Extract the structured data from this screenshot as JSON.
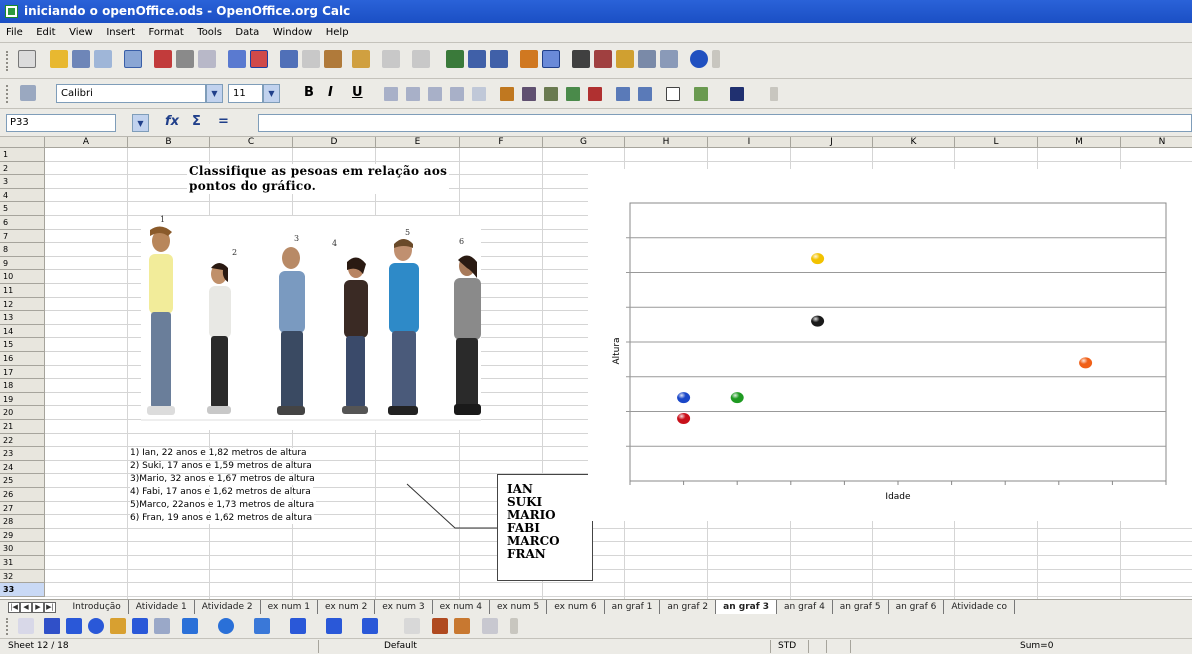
{
  "window": {
    "title": "iniciando o openOffice.ods - OpenOffice.org Calc"
  },
  "menu": [
    "File",
    "Edit",
    "View",
    "Insert",
    "Format",
    "Tools",
    "Data",
    "Window",
    "Help"
  ],
  "format_toolbar": {
    "font_name": "Calibri",
    "font_size": "11",
    "bold": "B",
    "italic": "I",
    "underline": "U"
  },
  "formula_bar": {
    "cell_ref": "P33",
    "fx": "fx",
    "sum": "Σ",
    "equals": "="
  },
  "columns": [
    "A",
    "B",
    "C",
    "D",
    "E",
    "F",
    "G",
    "H",
    "I",
    "J",
    "K",
    "L",
    "M",
    "N"
  ],
  "rows": [
    "1",
    "2",
    "3",
    "4",
    "5",
    "6",
    "7",
    "8",
    "9",
    "10",
    "11",
    "12",
    "13",
    "14",
    "15",
    "16",
    "17",
    "18",
    "19",
    "20",
    "21",
    "22",
    "23",
    "24",
    "25",
    "26",
    "27",
    "28",
    "29",
    "30",
    "31",
    "32",
    "33"
  ],
  "question": {
    "line1": "Classifique as pesoas em relação aos",
    "line2": "pontos do gráfico."
  },
  "photo_numbers": [
    "1",
    "2",
    "3",
    "4",
    "5",
    "6"
  ],
  "descriptions": [
    "1) Ian, 22 anos e 1,82 metros de altura",
    "2) Suki, 17 anos e 1,59 metros de altura",
    "3)Mario, 32 anos  e 1,67 metros de altura",
    "4) Fabi, 17 anos e 1,62 metros de altura",
    "5)Marco, 22anos e 1,73 metros de altura",
    "6) Fran, 19 anos e 1,62 metros de altura"
  ],
  "legend": [
    {
      "name": "IAN",
      "color": "#f0f020"
    },
    {
      "name": "SUKI",
      "color": "#e8141c"
    },
    {
      "name": "MARIO",
      "color": "#ff7a1a"
    },
    {
      "name": "FABI",
      "color": "#1440b8"
    },
    {
      "name": "MARCO",
      "color": "#333333"
    },
    {
      "name": "FRAN",
      "color": "#28d02c"
    }
  ],
  "chart_data": {
    "type": "scatter",
    "xlabel": "Idade",
    "ylabel": "Altura",
    "title": "",
    "grid": true,
    "x_range": [
      15,
      35
    ],
    "y_range": [
      1.5,
      1.9
    ],
    "points": [
      {
        "x": 22,
        "y": 1.82,
        "color": "#f2c200"
      },
      {
        "x": 22,
        "y": 1.73,
        "color": "#1a1a1a"
      },
      {
        "x": 32,
        "y": 1.67,
        "color": "#f06018"
      },
      {
        "x": 17,
        "y": 1.62,
        "color": "#1a47c8"
      },
      {
        "x": 19,
        "y": 1.62,
        "color": "#1f9a22"
      },
      {
        "x": 17,
        "y": 1.59,
        "color": "#c8101a"
      }
    ]
  },
  "sheet_tabs": [
    "Introdução",
    "Atividade 1",
    "Atividade 2",
    "ex num 1",
    "ex num 2",
    "ex num 3",
    "ex num 4",
    "ex num 5",
    "ex num 6",
    "an graf 1",
    "an graf 2",
    "an graf 3",
    "an graf 4",
    "an graf 5",
    "an graf 6",
    "Atividade co"
  ],
  "active_tab": "an graf 3",
  "status": {
    "sheet": "Sheet 12 / 18",
    "style": "Default",
    "mode": "STD",
    "sum": "Sum=0"
  }
}
